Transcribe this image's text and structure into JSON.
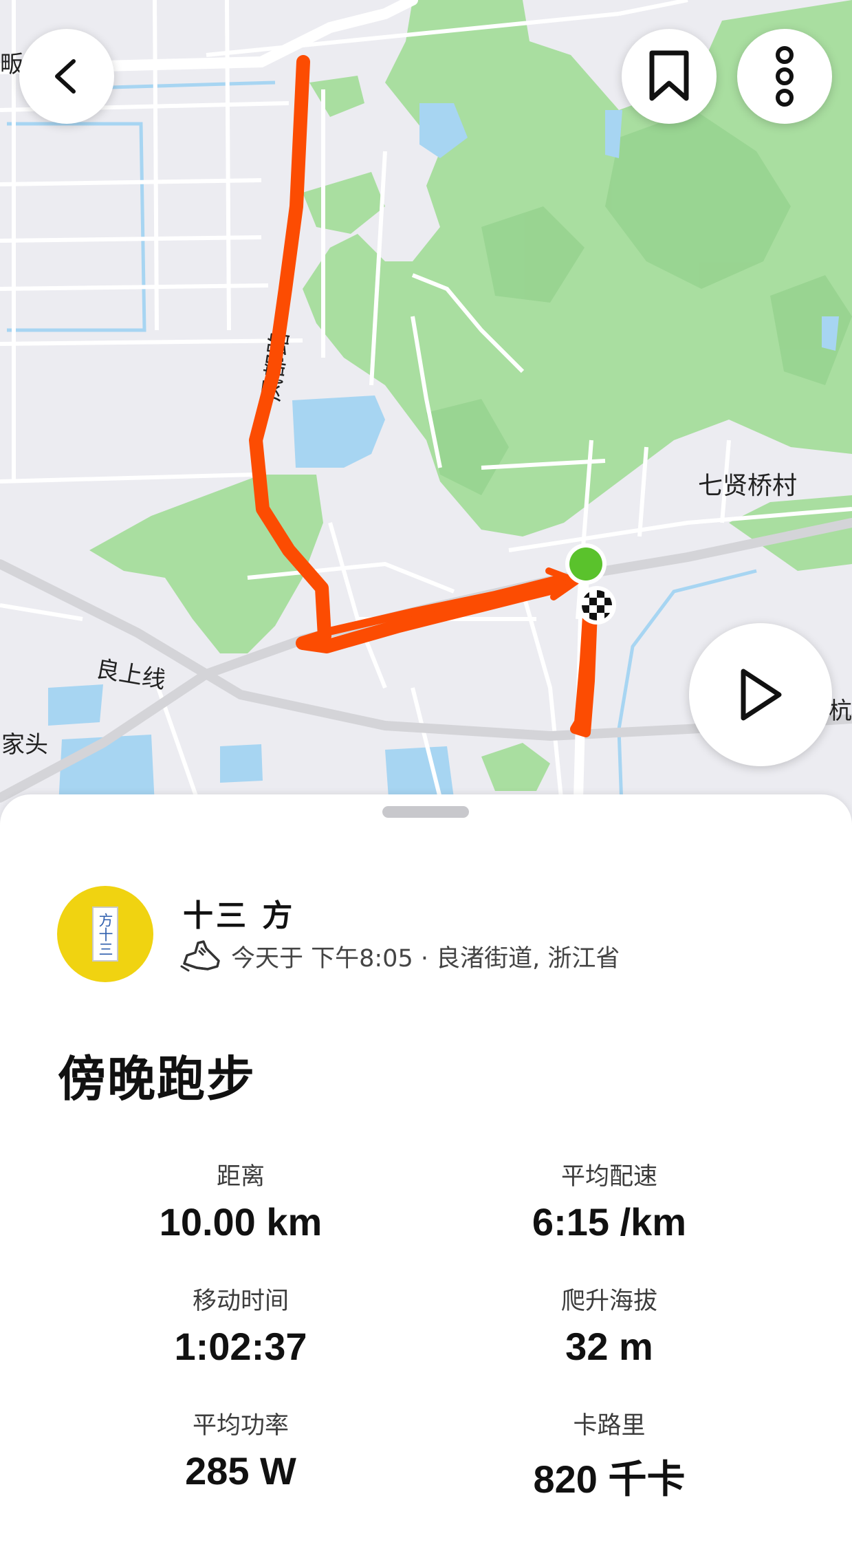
{
  "map": {
    "labels": {
      "road_fengdu": "凤都路",
      "village_qixianqiao": "七贤桥村",
      "line_liangshang": "良上线",
      "place_left_edge": "家头",
      "place_top_left": "畈",
      "place_right_edge": "杭"
    },
    "colors": {
      "route": "#fc4c02",
      "start_marker": "#5ac22c",
      "park": "#a9dea0",
      "water": "#a7d5f2",
      "land": "#ececf1"
    }
  },
  "toolbar": {
    "back_icon": "chevron-left-icon",
    "bookmark_icon": "bookmark-icon",
    "more_icon": "more-vertical-icon"
  },
  "play_icon": "play-icon",
  "activity": {
    "athlete_name": "十三 方",
    "avatar_text": "方十三",
    "sport_icon": "running-shoe-icon",
    "meta": "今天于 下午8:05 · 良渚街道, 浙江省",
    "title": "傍晚跑步"
  },
  "stats": [
    {
      "label": "距离",
      "value": "10.00 km"
    },
    {
      "label": "平均配速",
      "value": "6:15 /km"
    },
    {
      "label": "移动时间",
      "value": "1:02:37"
    },
    {
      "label": "爬升海拔",
      "value": "32 m"
    },
    {
      "label": "平均功率",
      "value": "285 W"
    },
    {
      "label": "卡路里",
      "value": "820 千卡"
    }
  ]
}
